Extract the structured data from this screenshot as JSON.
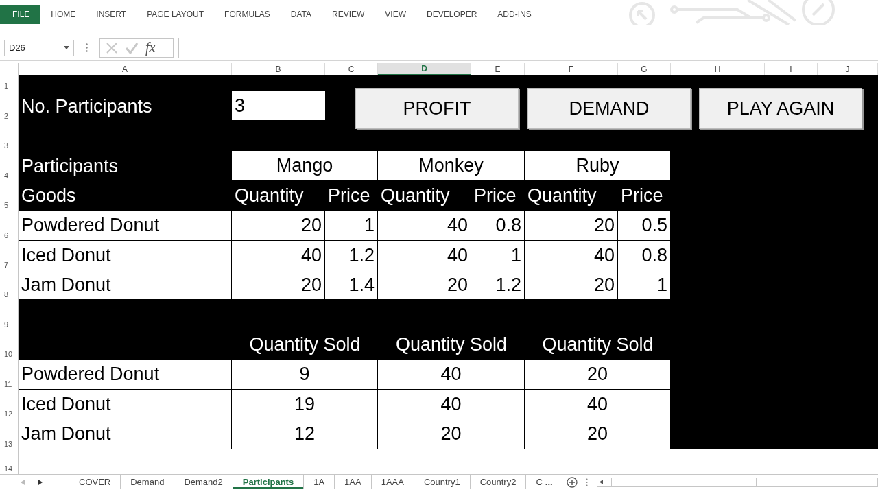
{
  "ribbon_tabs": [
    {
      "label": "FILE",
      "kind": "file"
    },
    {
      "label": "HOME",
      "kind": "tab"
    },
    {
      "label": "INSERT",
      "kind": "tab"
    },
    {
      "label": "PAGE LAYOUT",
      "kind": "tab"
    },
    {
      "label": "FORMULAS",
      "kind": "tab"
    },
    {
      "label": "DATA",
      "kind": "tab"
    },
    {
      "label": "REVIEW",
      "kind": "tab"
    },
    {
      "label": "VIEW",
      "kind": "tab"
    },
    {
      "label": "DEVELOPER",
      "kind": "tab"
    },
    {
      "label": "ADD-INS",
      "kind": "tab"
    }
  ],
  "name_box": "D26",
  "formula_bar": {
    "function_label": "fx"
  },
  "columns": [
    {
      "label": "A",
      "selected": false
    },
    {
      "label": "B",
      "selected": false
    },
    {
      "label": "C",
      "selected": false
    },
    {
      "label": "D",
      "selected": true
    },
    {
      "label": "E",
      "selected": false
    },
    {
      "label": "F",
      "selected": false
    },
    {
      "label": "G",
      "selected": false
    },
    {
      "label": "H",
      "selected": false
    },
    {
      "label": "I",
      "selected": false
    },
    {
      "label": "J",
      "selected": false
    }
  ],
  "row_numbers": [
    "1",
    "2",
    "3",
    "4",
    "5",
    "6",
    "7",
    "8",
    "9",
    "10",
    "11",
    "12",
    "13",
    "14"
  ],
  "participants_count": {
    "label": "No. Participants",
    "value": "3"
  },
  "buttons": [
    "PROFIT",
    "DEMAND",
    "PLAY AGAIN"
  ],
  "offers": {
    "header_label": "Participants",
    "participants": [
      "Mango",
      "Monkey",
      "Ruby"
    ],
    "goods_label": "Goods",
    "subheaders": [
      "Quantity",
      "Price",
      "Quantity",
      "Price",
      "Quantity",
      "Price"
    ],
    "rows": [
      {
        "good": "Powdered Donut",
        "values": [
          "20",
          "1",
          "40",
          "0.8",
          "20",
          "0.5"
        ]
      },
      {
        "good": "Iced Donut",
        "values": [
          "40",
          "1.2",
          "40",
          "1",
          "40",
          "0.8"
        ]
      },
      {
        "good": "Jam Donut",
        "values": [
          "20",
          "1.4",
          "20",
          "1.2",
          "20",
          "1"
        ]
      }
    ]
  },
  "sales": {
    "headers": [
      "Quantity Sold",
      "Quantity Sold",
      "Quantity Sold"
    ],
    "rows": [
      {
        "good": "Powdered Donut",
        "values": [
          "9",
          "40",
          "20"
        ]
      },
      {
        "good": "Iced Donut",
        "values": [
          "19",
          "40",
          "40"
        ]
      },
      {
        "good": "Jam Donut",
        "values": [
          "12",
          "20",
          "20"
        ]
      }
    ]
  },
  "sheet_tabs": [
    {
      "label": "COVER",
      "selected": false
    },
    {
      "label": "Demand",
      "selected": false
    },
    {
      "label": "Demand2",
      "selected": false
    },
    {
      "label": "Participants",
      "selected": true
    },
    {
      "label": "1A",
      "selected": false
    },
    {
      "label": "1AA",
      "selected": false
    },
    {
      "label": "1AAA",
      "selected": false
    },
    {
      "label": "Country1",
      "selected": false
    },
    {
      "label": "Country2",
      "selected": false
    },
    {
      "label": "C",
      "selected": false
    }
  ],
  "tab_overflow": "..."
}
